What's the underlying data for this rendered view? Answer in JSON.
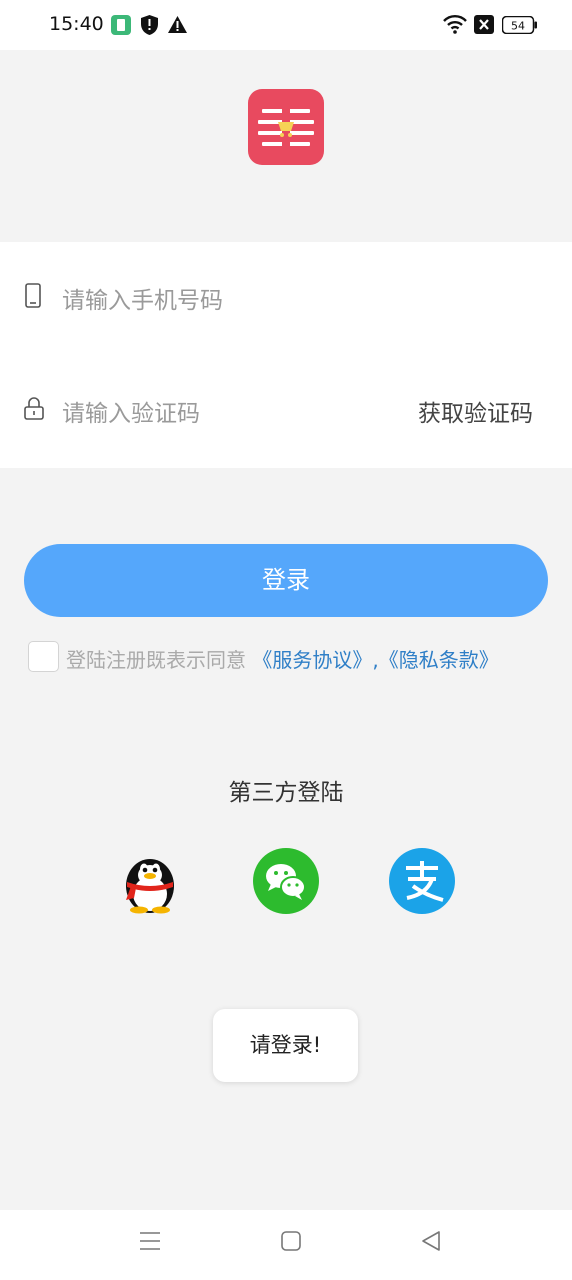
{
  "status_bar": {
    "time": "15:40",
    "battery": "54",
    "icons": [
      "app-notification-icon",
      "shield-icon",
      "warning-icon",
      "wifi-icon",
      "no-sim-icon",
      "battery-icon"
    ]
  },
  "app": {
    "logo_icon": "shopping-cart-logo-icon",
    "logo_color": "#e84a5f"
  },
  "form": {
    "phone_placeholder": "请输入手机号码",
    "code_placeholder": "请输入验证码",
    "get_code_label": "获取验证码"
  },
  "login": {
    "button_label": "登录",
    "button_color": "#55a7fb"
  },
  "agreement": {
    "text": "登陆注册既表示同意",
    "service_link": "《服务协议》",
    "separator": ",",
    "privacy_link": "《隐私条款》",
    "link_color": "#2f7fc7",
    "checked": false
  },
  "third_party": {
    "title": "第三方登陆",
    "providers": [
      "qq-icon",
      "wechat-icon",
      "alipay-icon"
    ]
  },
  "toast": {
    "message": "请登录!"
  },
  "nav": {
    "buttons": [
      "menu-icon",
      "home-icon",
      "back-icon"
    ]
  }
}
